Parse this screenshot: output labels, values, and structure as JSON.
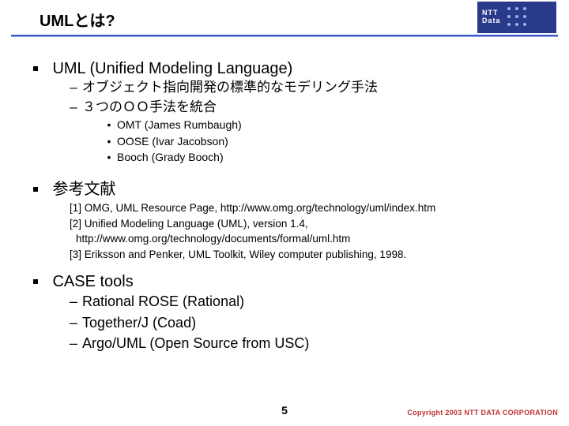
{
  "header": {
    "title": "UMLとは?",
    "logo_line1": "NTT",
    "logo_line2": "Data"
  },
  "sections": {
    "uml": {
      "heading": "UML (Unified Modeling Language)",
      "sub1": "オブジェクト指向開発の標準的なモデリング手法",
      "sub2": "３つのＯＯ手法を統合",
      "m1": "OMT  (James Rumbaugh)",
      "m2": "OOSE (Ivar Jacobson)",
      "m3": "Booch (Grady Booch)"
    },
    "refs": {
      "heading": "参考文献",
      "r1": "[1] OMG, UML Resource Page, http://www.omg.org/technology/uml/index.htm",
      "r2a": "[2] Unified Modeling Language (UML), version 1.4,",
      "r2b": "http://www.omg.org/technology/documents/formal/uml.htm",
      "r3": "[3] Eriksson and Penker, UML Toolkit, Wiley computer publishing, 1998."
    },
    "tools": {
      "heading": "CASE tools",
      "t1": "Rational ROSE (Rational)",
      "t2": "Together/J (Coad)",
      "t3": "Argo/UML (Open Source from USC)"
    }
  },
  "footer": {
    "page": "5",
    "copyright": "Copyright 2003 NTT DATA CORPORATION"
  }
}
